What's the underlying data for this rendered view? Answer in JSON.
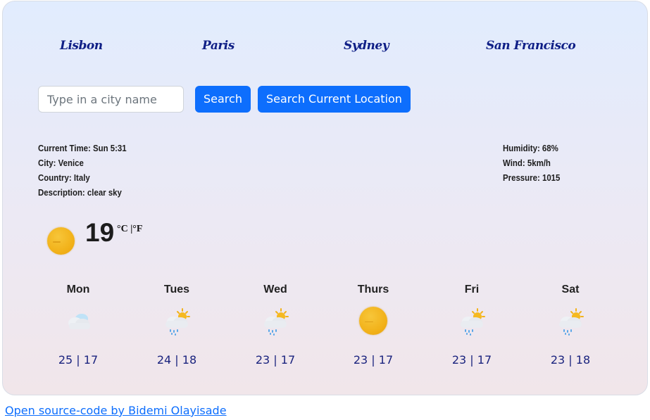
{
  "cities": [
    "Lisbon",
    "Paris",
    "Sydney",
    "San Francisco"
  ],
  "search": {
    "placeholder": "Type in a city name",
    "search_label": "Search",
    "current_location_label": "Search Current Location"
  },
  "current": {
    "time": "Current Time: Sun 5:31",
    "city": "City: Venice",
    "country": "Country: Italy",
    "description": "Description: clear sky",
    "humidity": "Humidity: 68%",
    "wind": "Wind: 5km/h",
    "pressure": "Pressure: 1015",
    "temperature": "19",
    "units": "°C |°F",
    "icon": "sun-icon"
  },
  "forecast": [
    {
      "day": "Mon",
      "temps": "25 | 17",
      "icon": "cloud-icon"
    },
    {
      "day": "Tues",
      "temps": "24 | 18",
      "icon": "sun-cloud-rain-icon"
    },
    {
      "day": "Wed",
      "temps": "23 | 17",
      "icon": "sun-cloud-rain-icon"
    },
    {
      "day": "Thurs",
      "temps": "23 | 17",
      "icon": "sun-icon"
    },
    {
      "day": "Fri",
      "temps": "23 | 17",
      "icon": "sun-cloud-rain-icon"
    },
    {
      "day": "Sat",
      "temps": "23 | 18",
      "icon": "sun-cloud-rain-icon"
    }
  ],
  "footer": {
    "link_text": "Open source-code by Bidemi Olayisade"
  },
  "colors": {
    "accent": "#0d6efd",
    "city_link": "#0f1f86",
    "forecast_temps": "#1a237e"
  }
}
